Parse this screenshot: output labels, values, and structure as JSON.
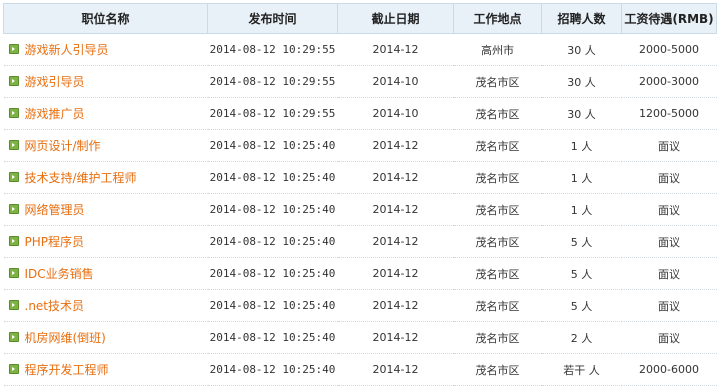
{
  "headers": {
    "title": "职位名称",
    "posted": "发布时间",
    "deadline": "截止日期",
    "location": "工作地点",
    "headcount": "招聘人数",
    "salary": "工资待遇(RMB)"
  },
  "rows": [
    {
      "title": "游戏新人引导员",
      "posted": "2014-08-12 10:29:55",
      "deadline": "2014-12",
      "location": "高州市",
      "headcount": "30 人",
      "salary": "2000-5000"
    },
    {
      "title": "游戏引导员",
      "posted": "2014-08-12 10:29:55",
      "deadline": "2014-10",
      "location": "茂名市区",
      "headcount": "30 人",
      "salary": "2000-3000"
    },
    {
      "title": "游戏推广员",
      "posted": "2014-08-12 10:29:55",
      "deadline": "2014-10",
      "location": "茂名市区",
      "headcount": "30 人",
      "salary": "1200-5000"
    },
    {
      "title": "网页设计/制作",
      "posted": "2014-08-12 10:25:40",
      "deadline": "2014-12",
      "location": "茂名市区",
      "headcount": "1 人",
      "salary": "面议"
    },
    {
      "title": "技术支持/维护工程师",
      "posted": "2014-08-12 10:25:40",
      "deadline": "2014-12",
      "location": "茂名市区",
      "headcount": "1 人",
      "salary": "面议"
    },
    {
      "title": "网络管理员",
      "posted": "2014-08-12 10:25:40",
      "deadline": "2014-12",
      "location": "茂名市区",
      "headcount": "1 人",
      "salary": "面议"
    },
    {
      "title": "PHP程序员",
      "posted": "2014-08-12 10:25:40",
      "deadline": "2014-12",
      "location": "茂名市区",
      "headcount": "5 人",
      "salary": "面议"
    },
    {
      "title": "IDC业务销售",
      "posted": "2014-08-12 10:25:40",
      "deadline": "2014-12",
      "location": "茂名市区",
      "headcount": "5 人",
      "salary": "面议"
    },
    {
      "title": ".net技术员",
      "posted": "2014-08-12 10:25:40",
      "deadline": "2014-12",
      "location": "茂名市区",
      "headcount": "5 人",
      "salary": "面议"
    },
    {
      "title": "机房网维(倒班)",
      "posted": "2014-08-12 10:25:40",
      "deadline": "2014-12",
      "location": "茂名市区",
      "headcount": "2 人",
      "salary": "面议"
    },
    {
      "title": "程序开发工程师",
      "posted": "2014-08-12 10:25:40",
      "deadline": "2014-12",
      "location": "茂名市区",
      "headcount": "若干 人",
      "salary": "2000-6000"
    }
  ]
}
